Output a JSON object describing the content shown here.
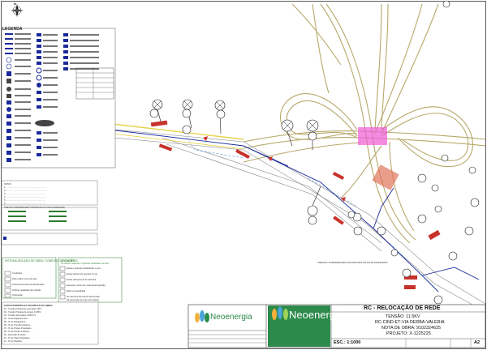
{
  "legend": {
    "title": "LEGENDA"
  },
  "notes": {
    "lines": [
      "NOTAS",
      "1 - ..................................................................",
      "2 - ..................................................................",
      "3 - ..................................................................",
      "4 - ..................................................................",
      "5 - ..................................................................",
      "6 - ..................................................................",
      "TRECHO SUBTERRANEO PROJETADO NA NOTA 9102324625"
    ]
  },
  "characteristics": {
    "title": "CARACTERISTICAS TECNICAS DA OBRA",
    "rows": [
      "01 - Tensão Primária de operação   13KV",
      "02 - Tensão Primária de projeto   13,8KV",
      "03 - Tensão Secundária   220/127V",
      "04 - Nº de Equipamentos   -",
      "05 - Nº de Religadores   -",
      "06 - Nº de Transformadores   -",
      "07 - Nº de Postes Projetados   -",
      "08 - Nº de Postes a Retirar   -",
      "09 - Extensão de Rede   -",
      "10 - Nº de Vãos Projetados   -",
      "11 - Nº de Padrões   -"
    ]
  },
  "checklist_left": {
    "title": "SISTEMA ISOLADO DE OBRA / CONEXÃO DE CLIENTES",
    "items": [
      "Condições",
      "Para mudar nome da rede",
      "Acrescentar placa de identificação",
      "Verificar qualidade da medição",
      "Ordenação"
    ]
  },
  "checklist_right": {
    "title": "ATENÇÃO",
    "subtitle": "Os riscos / Aspectos / Impactos verificados na obra:",
    "items": [
      "Existem pessoas trabalhando na via",
      "Existe trânsito de veículos na via",
      "Existe cabeamento de telefonia",
      "Executar a obra com rede desenergizada",
      "Rede compartilhada",
      "Ver abertura da rede de alta tensão",
      "Dá prevenção de ruas Ferroviárias"
    ]
  },
  "title_block": {
    "title": "RC - RELOCAÇÃO DE REDE",
    "tensao": "TENSÃO: 11.5KV",
    "address": "RC-CIND-ET-VIA DERBA-VALERIA",
    "nota": "NOTA DE OBRA: 9102324625",
    "projeto": "PROJETO: X-1225225",
    "scale": "ESC.: 1:1000",
    "sheet_label": "A2",
    "logo_text_1": "Neoenergia",
    "logo_text_2": "Neoenergia"
  },
  "map": {
    "annotation": "TRECHO SUBTERRANEO PROJETADO NA NOTA 9102324625"
  },
  "north_arrow": {
    "label": "N"
  },
  "colors": {
    "road": "#b7a86a",
    "network": "#1a2a9a",
    "highlight": "#f05bd6",
    "brand": "#2c8a4a",
    "red": "#c8322a"
  }
}
